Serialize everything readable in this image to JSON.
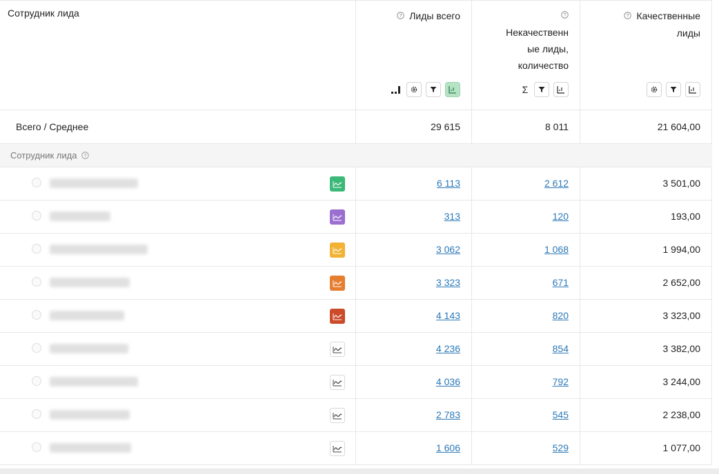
{
  "header": {
    "employee": "Сотрудник лида",
    "col_leads_total": "Лиды всего",
    "col_bad_leads_1": "Некачественн",
    "col_bad_leads_2": "ые лиды,",
    "col_bad_leads_3": "количество",
    "col_quality_1": "Качественные",
    "col_quality_2": "лиды",
    "help_glyph": "?",
    "sigma": "Σ"
  },
  "total": {
    "label": "Всего / Среднее",
    "leads_total": "29 615",
    "bad_leads": "8 011",
    "quality_leads": "21 604,00"
  },
  "group": {
    "label": "Сотрудник лида"
  },
  "rows": [
    {
      "spark_color": "#3cb878",
      "leads_total": "6 113",
      "bad_leads": "2 612",
      "quality_leads": "3 501,00"
    },
    {
      "spark_color": "#9b6fcf",
      "leads_total": "313",
      "bad_leads": "120",
      "quality_leads": "193,00"
    },
    {
      "spark_color": "#f2b233",
      "leads_total": "3 062",
      "bad_leads": "1 068",
      "quality_leads": "1 994,00"
    },
    {
      "spark_color": "#e67e30",
      "leads_total": "3 323",
      "bad_leads": "671",
      "quality_leads": "2 652,00"
    },
    {
      "spark_color": "#cc4b2a",
      "leads_total": "4 143",
      "bad_leads": "820",
      "quality_leads": "3 323,00"
    },
    {
      "spark_color": "",
      "leads_total": "4 236",
      "bad_leads": "854",
      "quality_leads": "3 382,00"
    },
    {
      "spark_color": "",
      "leads_total": "4 036",
      "bad_leads": "792",
      "quality_leads": "3 244,00"
    },
    {
      "spark_color": "",
      "leads_total": "2 783",
      "bad_leads": "545",
      "quality_leads": "2 238,00"
    },
    {
      "spark_color": "",
      "leads_total": "1 606",
      "bad_leads": "529",
      "quality_leads": "1 077,00"
    }
  ],
  "icons": {
    "help": "question-circle-icon",
    "settings": "gear-icon",
    "filter": "filter-icon",
    "chart": "chart-toggle-icon",
    "sum": "sigma-icon",
    "bars": "bar-sort-icon",
    "spark": "sparkline-icon",
    "row_marker": "avatar-placeholder-icon"
  }
}
